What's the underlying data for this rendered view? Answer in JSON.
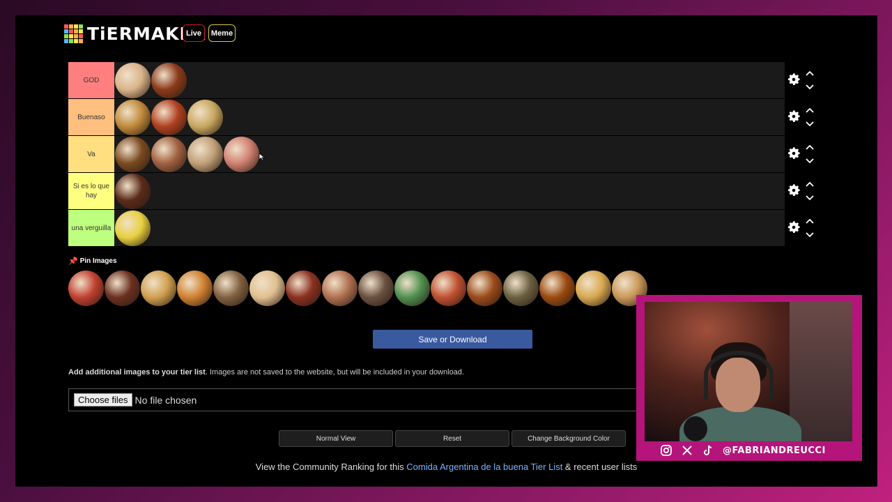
{
  "header": {
    "logo_text": "TiERMAKER",
    "logo_colors": [
      "#ff5a5a",
      "#ffb24a",
      "#ffe64a",
      "#8ee05a",
      "#5ab4ff",
      "#ff5a5a",
      "#ffb24a",
      "#ffe64a",
      "#8ee05a",
      "#ffe64a",
      "#ffb24a",
      "#ff5a5a",
      "#5ab4ff",
      "#8ee05a",
      "#ffe64a",
      "#ffb24a"
    ],
    "live_label": "Live",
    "meme_label": "Meme"
  },
  "tiers": [
    {
      "label": "GOD",
      "color": "#ff7f7f",
      "items": [
        "#d9b48a",
        "#8a3a1a"
      ]
    },
    {
      "label": "Buenaso",
      "color": "#ffbf7f",
      "items": [
        "#c08a3a",
        "#b04020",
        "#c8a860"
      ]
    },
    {
      "label": "Va",
      "color": "#ffdf7f",
      "items": [
        "#7a4a20",
        "#a06040",
        "#c0a078",
        "#d08070"
      ]
    },
    {
      "label": "Si es lo que hay",
      "color": "#ffff7f",
      "items": [
        "#5a2a1a"
      ]
    },
    {
      "label": "una verguilla",
      "color": "#bfff7f",
      "items": [
        "#e8d040"
      ]
    }
  ],
  "pin_label": "Pin Images",
  "pool": [
    "#c04030",
    "#6a3020",
    "#d0a050",
    "#d08030",
    "#806040",
    "#e0c090",
    "#8a3020",
    "#b07050",
    "#6a5040",
    "#509050",
    "#c05030",
    "#9a4a1a",
    "#6a6040",
    "#9a4a10",
    "#d8a850",
    "#c89858"
  ],
  "save_label": "Save or Download",
  "info": {
    "bold": "Add additional images to your tier list",
    "rest": ". Images are not saved to the website, but will be included in your download."
  },
  "file_input": {
    "button": "Choose files",
    "status": "No file chosen"
  },
  "view_buttons": [
    "Normal View",
    "Reset",
    "Change Background Color"
  ],
  "community": {
    "prefix": "View the Community Ranking for this ",
    "link": "Comida Argentina de la buena Tier List",
    "suffix": " & recent user lists"
  },
  "webcam": {
    "handle": "@FABRIANDREUCCI",
    "social_icons": [
      "instagram-icon",
      "x-icon",
      "tiktok-icon"
    ]
  }
}
